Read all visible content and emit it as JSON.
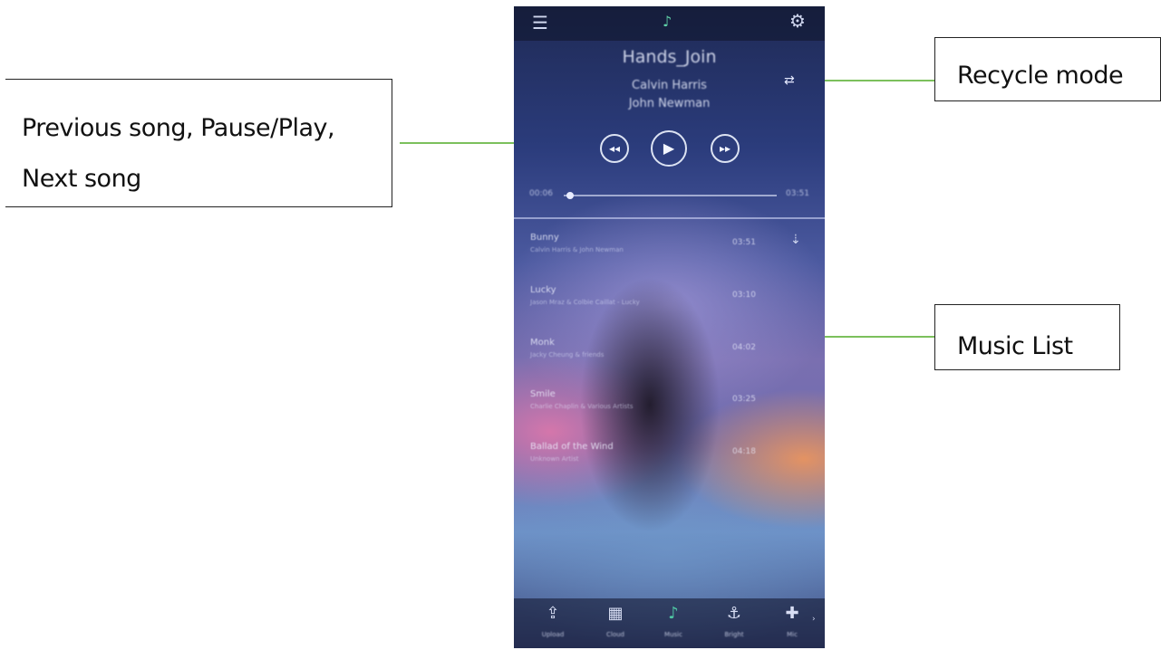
{
  "callouts": {
    "controls_line1": "Previous song, Pause/Play,",
    "controls_line2": "Next song",
    "recycle": "Recycle mode",
    "list": "Music List"
  },
  "now_playing": {
    "title": "Hands_Join",
    "artist_line1": "Calvin Harris",
    "artist_line2": "John Newman"
  },
  "progress": {
    "elapsed": "00:06",
    "total": "03:51",
    "fraction": 0.03
  },
  "songs": [
    {
      "title": "Bunny",
      "subtitle": "Calvin Harris & John Newman",
      "duration": "03:51"
    },
    {
      "title": "Lucky",
      "subtitle": "Jason Mraz & Colbie Caillat - Lucky",
      "duration": "03:10"
    },
    {
      "title": "Monk",
      "subtitle": "Jacky Cheung & friends",
      "duration": "04:02"
    },
    {
      "title": "Smile",
      "subtitle": "Charlie Chaplin & Various Artists",
      "duration": "03:25"
    },
    {
      "title": "Ballad of the Wind",
      "subtitle": "Unknown Artist",
      "duration": "04:18"
    }
  ],
  "tabs": [
    {
      "label": "Upload",
      "icon": "upload-icon"
    },
    {
      "label": "Cloud",
      "icon": "grid-icon"
    },
    {
      "label": "Music",
      "icon": "music-note-icon"
    },
    {
      "label": "Bright",
      "icon": "anchor-icon"
    },
    {
      "label": "Mic",
      "icon": "mic-icon"
    }
  ],
  "colors": {
    "arrow": "#7cc05c",
    "active_tab": "#4fc7a4"
  }
}
